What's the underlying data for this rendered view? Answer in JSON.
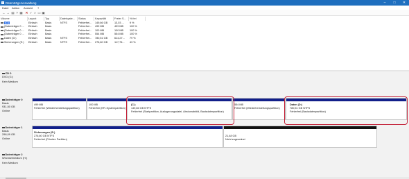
{
  "window": {
    "title": "Datenträgerverwaltung"
  },
  "menu": [
    "Datei",
    "Aktion",
    "Ansicht",
    "?"
  ],
  "toolbar_icons": [
    "back-icon",
    "forward-icon",
    "properties-icon",
    "help-icon",
    "refresh-icon",
    "delete-icon",
    "check-icon",
    "search-icon",
    "folder-icon",
    "view-icon"
  ],
  "table": {
    "columns": [
      "Volume",
      "Layout",
      "Typ",
      "Dateisyste...",
      "Status",
      "Kapazität",
      "Freier S...",
      "% frei"
    ],
    "rows": [
      [
        "(C:)",
        "Einfach",
        "Basis",
        "NTFS",
        "Fehlerfrei...",
        "149,66 GB",
        "13,03 ...",
        "9 %"
      ],
      [
        "(Datenträger 0 ...",
        "Einfach",
        "Basis",
        "",
        "Fehlerfrei...",
        "499 MB",
        "499 MB",
        "100 %"
      ],
      [
        "(Datenträger 0 ...",
        "Einfach",
        "Basis",
        "",
        "Fehlerfrei...",
        "100 MB",
        "100 MB",
        "100 %"
      ],
      [
        "(Datenträger 0 ...",
        "Einfach",
        "Basis",
        "",
        "Fehlerfrei...",
        "554 MB",
        "554 MB",
        "100 %"
      ],
      [
        "Daten (D:)",
        "Einfach",
        "Basis",
        "NTFS",
        "Fehlerfrei...",
        "780,51 GB",
        "614,27...",
        "79 %"
      ],
      [
        "Sicherungen (E:)",
        "Einfach",
        "Basis",
        "NTFS",
        "Fehlerfrei...",
        "276,60 GB",
        "117,76...",
        "43 %"
      ]
    ]
  },
  "disks": {
    "cd0": {
      "name": "CD 0",
      "drive": "DVD (G:)",
      "status": "Kein Medium"
    },
    "disk0": {
      "name": "Datenträger 0",
      "type": "Basis",
      "size": "931,50 GB",
      "status": "Online",
      "partitions": [
        {
          "title": "",
          "size": "499 MB",
          "desc": "Fehlerfrei (Wiederherstellungspartition)"
        },
        {
          "title": "",
          "size": "100 MB",
          "desc": "Fehlerfrei (EFI-Systempartition)"
        },
        {
          "title": "(C:)",
          "size": "149,66 GB NTFS",
          "desc": "Fehlerfrei (Startpartition, Auslagerungsdatei, Absturzabbild, Basisdatenpartition)"
        },
        {
          "title": "",
          "size": "554 MB",
          "desc": "Fehlerfrei (Wiederherstellungspartition)"
        },
        {
          "title": "Daten (D:)",
          "size": "780,51 GB NTFS",
          "desc": "Fehlerfrei (Basisdatenpartition)"
        }
      ]
    },
    "disk1": {
      "name": "Datenträger 1",
      "type": "Basis",
      "size": "298,09 GB",
      "status": "Online",
      "partitions": [
        {
          "title": "Sicherungen (E:)",
          "size": "276,60 GB NTFS",
          "desc": "Fehlerfrei (Primäre Partition)"
        },
        {
          "title": "",
          "size": "21,48 GB",
          "desc": "Nicht zugeordnet"
        }
      ]
    },
    "disk2": {
      "name": "Datenträger 2",
      "type": "Wechselmedium (H:)",
      "status": "Kein Medium"
    }
  },
  "colors": {
    "titlebar": "#1f6fbf",
    "partition_bar": "#12208a",
    "unallocated_bar": "#111111",
    "highlight": "#c4233a",
    "selection": "#3d7ae6"
  }
}
